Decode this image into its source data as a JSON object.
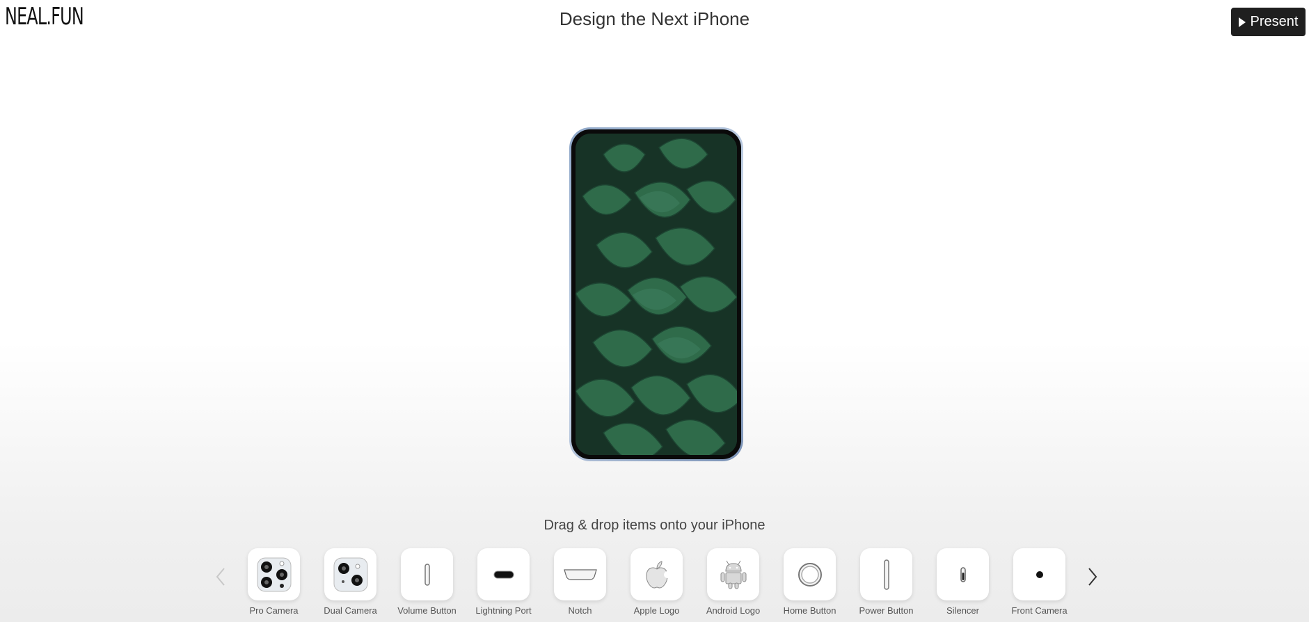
{
  "header": {
    "logo": "NEAL.FUN",
    "title": "Design the Next iPhone",
    "present_label": "Present"
  },
  "instruction": "Drag & drop items onto your iPhone",
  "tray": {
    "items": [
      {
        "label": "Pro Camera",
        "icon": "pro-camera-icon"
      },
      {
        "label": "Dual Camera",
        "icon": "dual-camera-icon"
      },
      {
        "label": "Volume Button",
        "icon": "volume-button-icon"
      },
      {
        "label": "Lightning Port",
        "icon": "lightning-port-icon"
      },
      {
        "label": "Notch",
        "icon": "notch-icon"
      },
      {
        "label": "Apple Logo",
        "icon": "apple-logo-icon"
      },
      {
        "label": "Android Logo",
        "icon": "android-logo-icon"
      },
      {
        "label": "Home Button",
        "icon": "home-button-icon"
      },
      {
        "label": "Power Button",
        "icon": "power-button-icon"
      },
      {
        "label": "Silencer",
        "icon": "silencer-icon"
      },
      {
        "label": "Front Camera",
        "icon": "front-camera-icon"
      }
    ]
  },
  "colors": {
    "present_bg": "#1f1f1f",
    "frame": "#8ea7c8",
    "screen_leaves": "#2f6b4a"
  }
}
